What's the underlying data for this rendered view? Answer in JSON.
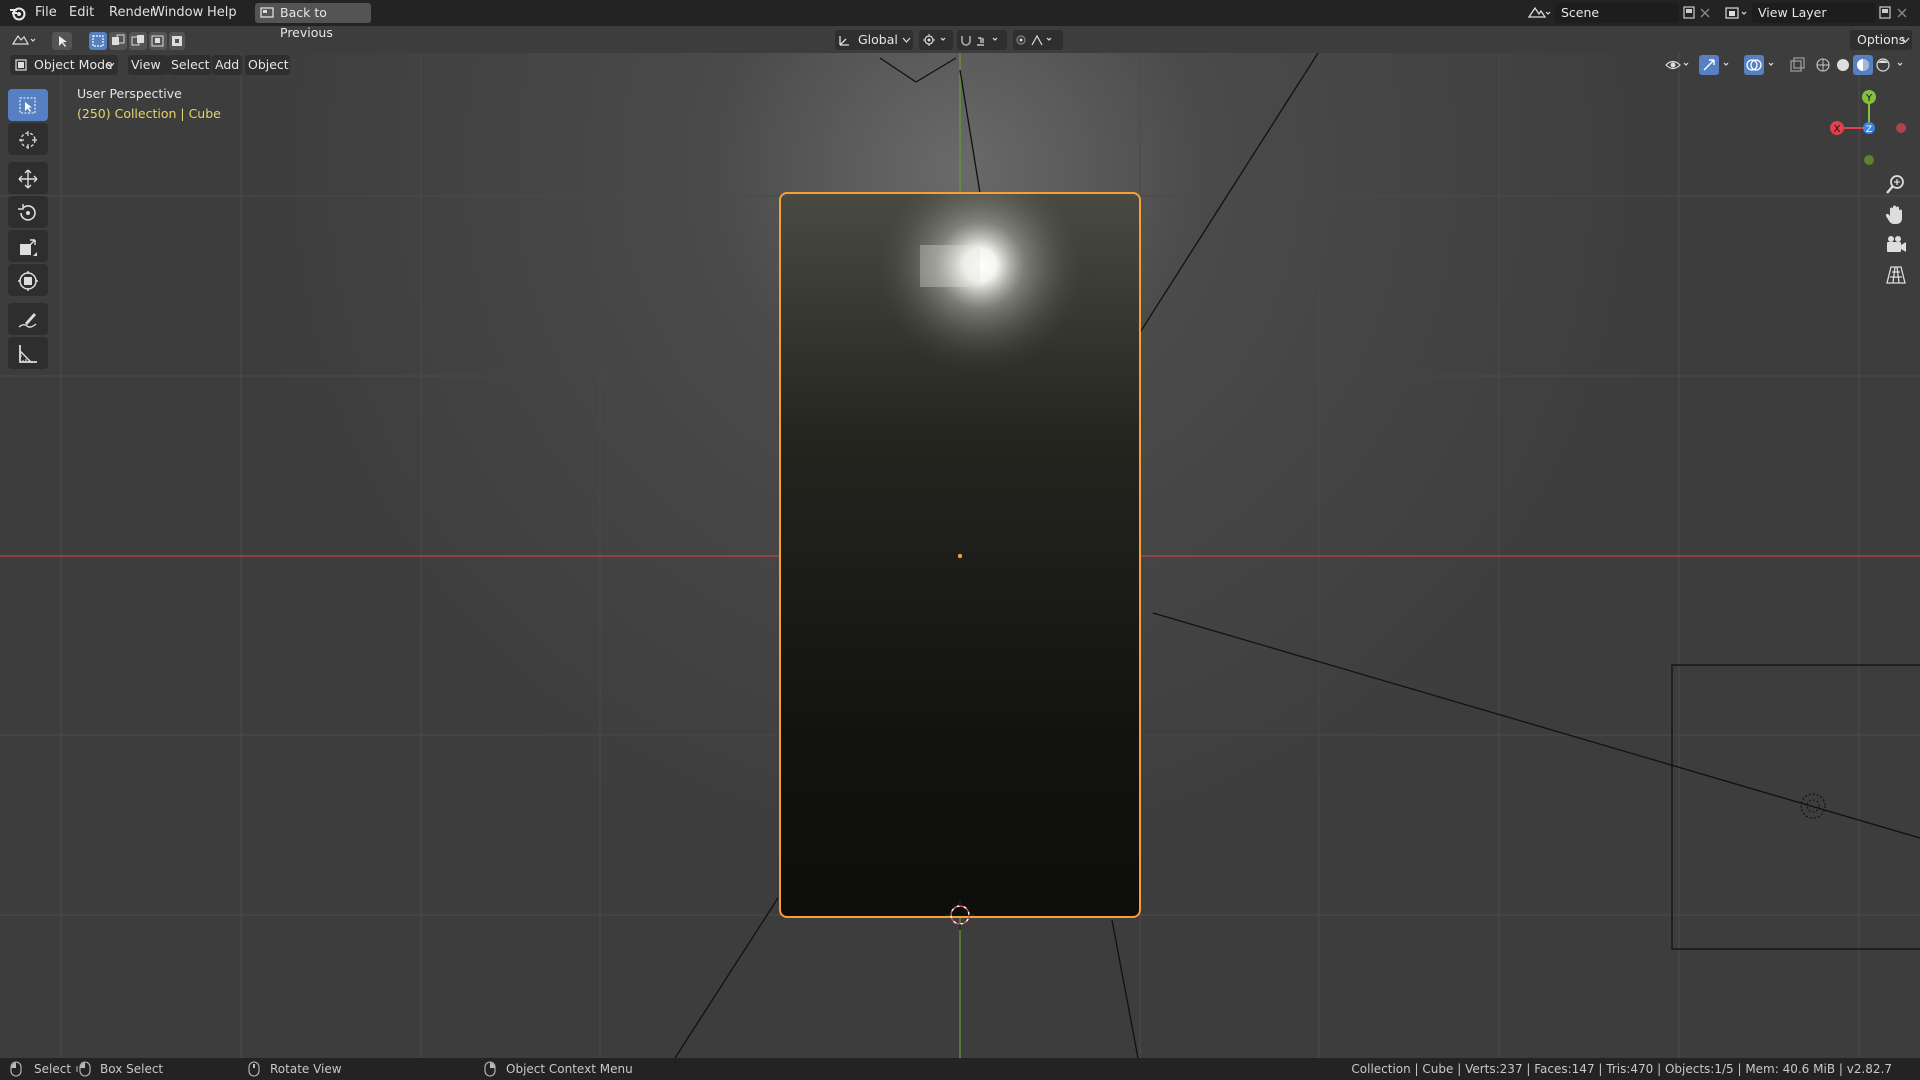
{
  "topbar": {
    "menus": [
      "File",
      "Edit",
      "Render",
      "Window",
      "Help"
    ],
    "back_button": "Back to Previous",
    "scene_value": "Scene",
    "view_layer_value": "View Layer"
  },
  "header": {
    "mode": "Object Mode",
    "menus": [
      "View",
      "Select",
      "Add",
      "Object"
    ],
    "transform_orientation": "Global",
    "options_label": "Options"
  },
  "viewport": {
    "perspective_label": "User Perspective",
    "collection_label": "(250) Collection | Cube",
    "gizmo": {
      "x": "X",
      "y": "Y",
      "z": "Z"
    }
  },
  "statusbar": {
    "select": "Select",
    "box_select": "Box Select",
    "rotate_view": "Rotate View",
    "context_menu": "Object Context Menu",
    "stats": "Collection | Cube | Verts:237 | Faces:147 | Tris:470 | Objects:1/5 | Mem: 40.6 MiB | v2.82.7"
  },
  "colors": {
    "selection_outline": "#f5a130",
    "x_axis": "#e0424d",
    "y_axis": "#86c13d",
    "z_axis": "#3f86e2",
    "active_tool": "#5680c2",
    "collection_text": "#e8d36a"
  }
}
